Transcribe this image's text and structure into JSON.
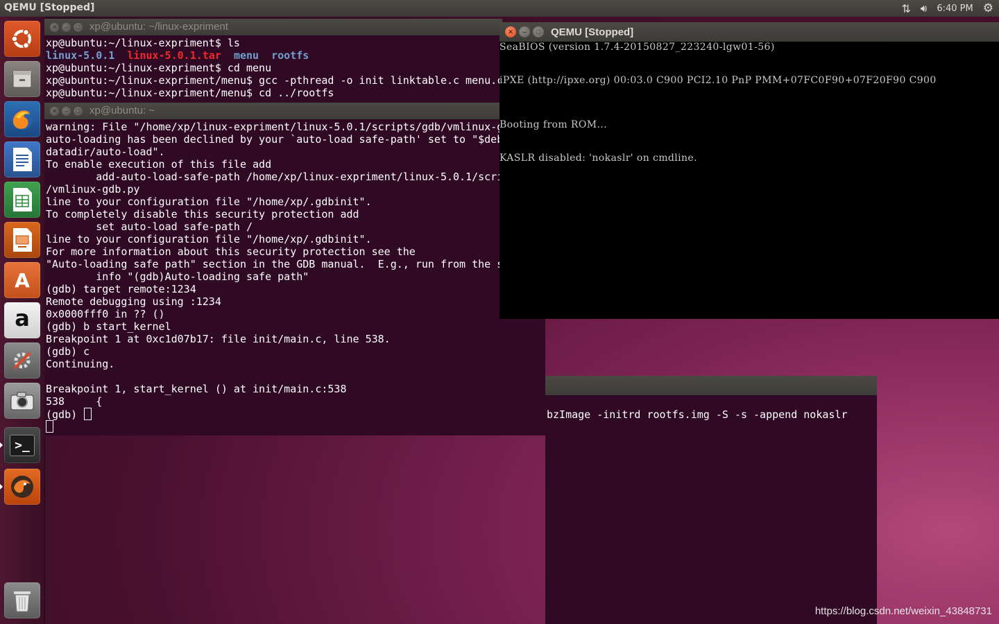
{
  "top_panel": {
    "title": "QEMU [Stopped]",
    "time": "6:40 PM",
    "network_icon": "network-updown-icon",
    "volume_icon": "volume-icon",
    "settings_icon": "gear-icon"
  },
  "launcher": {
    "items": [
      {
        "name": "ubuntu-dash",
        "icon": "ubuntu-logo-icon"
      },
      {
        "name": "files",
        "icon": "file-cabinet-icon"
      },
      {
        "name": "firefox",
        "icon": "firefox-icon"
      },
      {
        "name": "libreoffice-writer",
        "icon": "writer-document-icon"
      },
      {
        "name": "libreoffice-calc",
        "icon": "calc-spreadsheet-icon"
      },
      {
        "name": "libreoffice-impress",
        "icon": "impress-presentation-icon"
      },
      {
        "name": "ubuntu-software",
        "icon": "software-bag-icon",
        "glyph": "A"
      },
      {
        "name": "amazon",
        "icon": "amazon-icon",
        "glyph": "a"
      },
      {
        "name": "system-settings",
        "icon": "settings-tools-icon"
      },
      {
        "name": "screenshot",
        "icon": "camera-icon"
      },
      {
        "name": "terminal",
        "icon": "terminal-icon",
        "glyph": ">_"
      },
      {
        "name": "qemu",
        "icon": "qemu-icon"
      }
    ],
    "trash_icon": "trash-icon"
  },
  "term_back": {
    "title": "xp@ubuntu: ~/linux-expriment",
    "lines": [
      "xp@ubuntu:~/linux-expriment$ ls",
      "xp@ubuntu:~/linux-expriment$ cd menu",
      "xp@ubuntu:~/linux-expriment/menu$ gcc -pthread -o init linktable.c menu.c",
      "xp@ubuntu:~/linux-expriment/menu$ cd ../rootfs"
    ],
    "ls_items": [
      "linux-5.0.1",
      "linux-5.0.1.tar",
      "menu",
      "rootfs"
    ]
  },
  "term_front": {
    "title": "xp@ubuntu: ~",
    "lines": [
      "warning: File \"/home/xp/linux-expriment/linux-5.0.1/scripts/gdb/vmlinux-g",
      "auto-loading has been declined by your `auto-load safe-path' set to \"$deb",
      "datadir/auto-load\".",
      "To enable execution of this file add",
      "        add-auto-load-safe-path /home/xp/linux-expriment/linux-5.0.1/scri",
      "/vmlinux-gdb.py",
      "line to your configuration file \"/home/xp/.gdbinit\".",
      "To completely disable this security protection add",
      "        set auto-load safe-path /",
      "line to your configuration file \"/home/xp/.gdbinit\".",
      "For more information about this security protection see the",
      "\"Auto-loading safe path\" section in the GDB manual.  E.g., run from the s",
      "        info \"(gdb)Auto-loading safe path\"",
      "(gdb) target remote:1234",
      "Remote debugging using :1234",
      "0x0000fff0 in ?? ()",
      "(gdb) b start_kernel",
      "Breakpoint 1 at 0xc1d07b17: file init/main.c, line 538.",
      "(gdb) c",
      "Continuing.",
      "",
      "Breakpoint 1, start_kernel () at init/main.c:538",
      "538     {",
      "(gdb) "
    ]
  },
  "term_third": {
    "visible_line": "bzImage -initrd rootfs.img -S -s -append nokaslr"
  },
  "qemu": {
    "title": "QEMU [Stopped]",
    "lines": [
      "SeaBIOS (version 1.7.4-20150827_223240-lgw01-56)",
      "iPXE (http://ipxe.org) 00:03.0 C900 PCI2.10 PnP PMM+07FC0F90+07F20F90 C900",
      "Booting from ROM...",
      "KASLR disabled: 'nokaslr' on cmdline."
    ]
  },
  "watermark": "https://blog.csdn.net/weixin_43848731",
  "colors": {
    "terminal_bg": "#300a24",
    "ls_dir": "#729fcf",
    "ls_archive": "#ef2929",
    "panel": "#3c3b37"
  }
}
